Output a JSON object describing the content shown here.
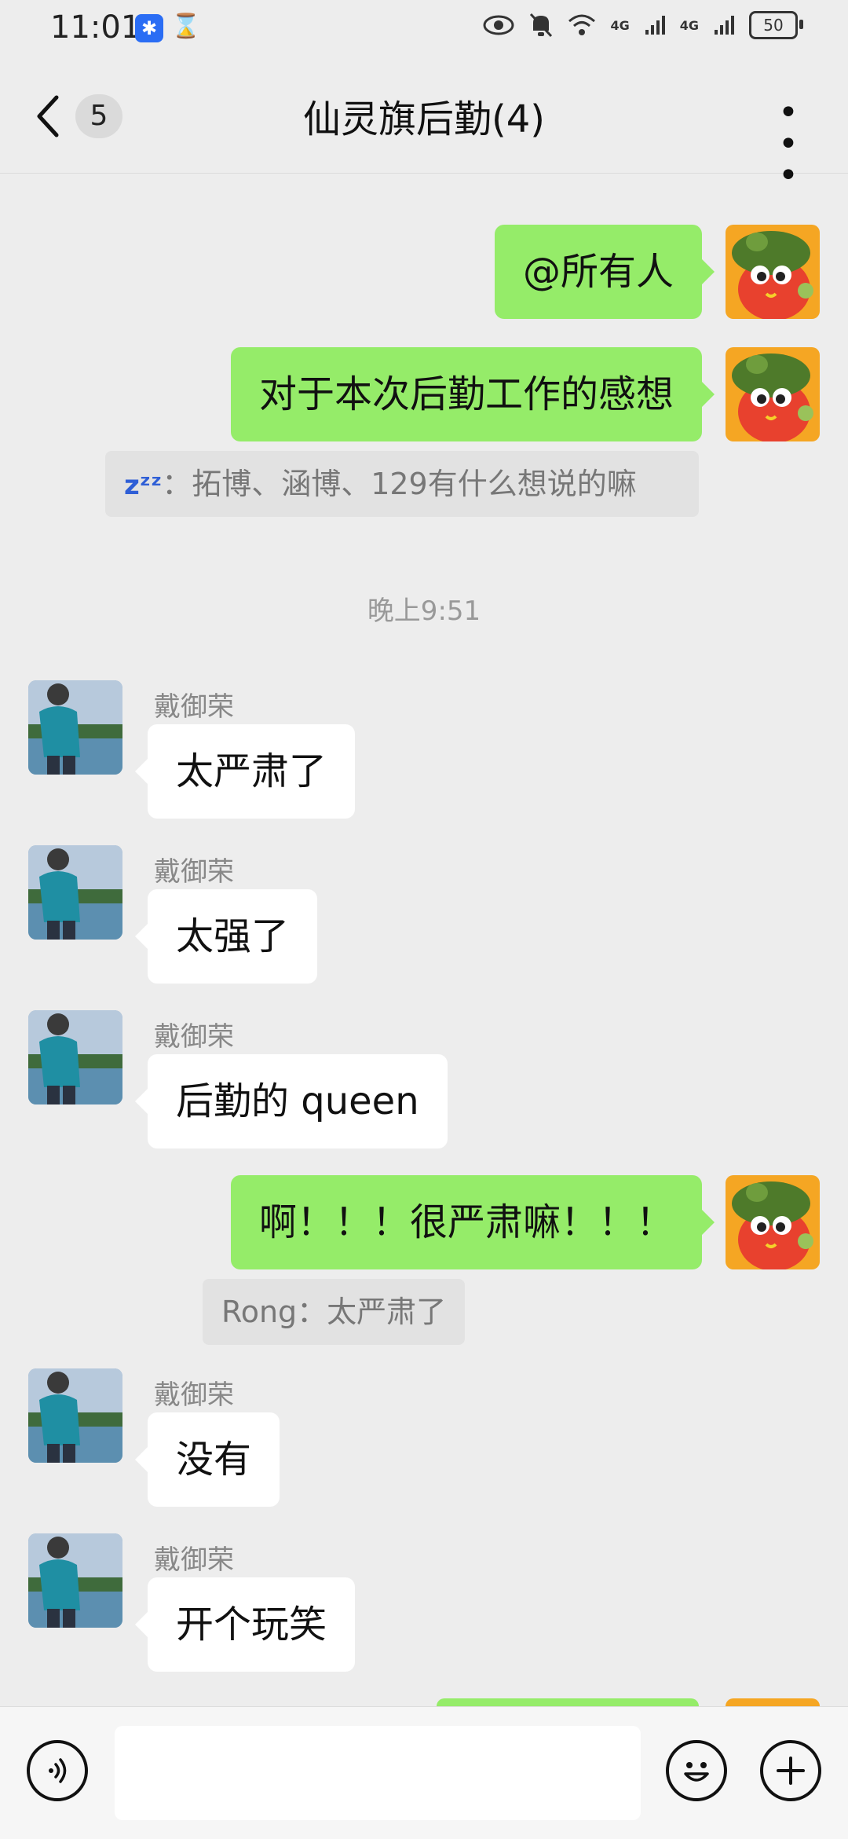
{
  "status_bar": {
    "time": "11:01",
    "app_icon": "notification-app-icon",
    "hourglass_icon": "hourglass-icon",
    "network_1": "4G",
    "network_2": "4G",
    "battery": "50"
  },
  "header": {
    "back_icon": "chevron-left-icon",
    "unread_count": "5",
    "title": "仙灵旗后勤(4)",
    "more_icon": "more-dots-icon"
  },
  "messages": [
    {
      "direction": "out",
      "text": "@所有人"
    },
    {
      "direction": "out",
      "text": "对于本次后勤工作的感想",
      "quote": {
        "prefix": "zᶻᶻ",
        "text": "：拓博、涵博、129有什么想说的嘛"
      }
    },
    {
      "type": "timestamp",
      "text": "晚上9:51"
    },
    {
      "direction": "in",
      "sender": "戴御荣",
      "text": "太严肃了"
    },
    {
      "direction": "in",
      "sender": "戴御荣",
      "text": "太强了"
    },
    {
      "direction": "in",
      "sender": "戴御荣",
      "text": "后勤的 queen"
    },
    {
      "direction": "out",
      "text": "啊！！！很严肃嘛！！！",
      "quote": {
        "text": "Rong：太严肃了"
      }
    },
    {
      "direction": "in",
      "sender": "戴御荣",
      "text": "没有"
    },
    {
      "direction": "in",
      "sender": "戴御荣",
      "text": "开个玩笑"
    }
  ],
  "input_bar": {
    "voice_icon": "voice-input-icon",
    "message_value": "",
    "emoji_icon": "emoji-icon",
    "plus_icon": "plus-icon"
  },
  "colors": {
    "background": "#ededed",
    "outgoing_bubble": "#95ec69",
    "incoming_bubble": "#ffffff"
  }
}
